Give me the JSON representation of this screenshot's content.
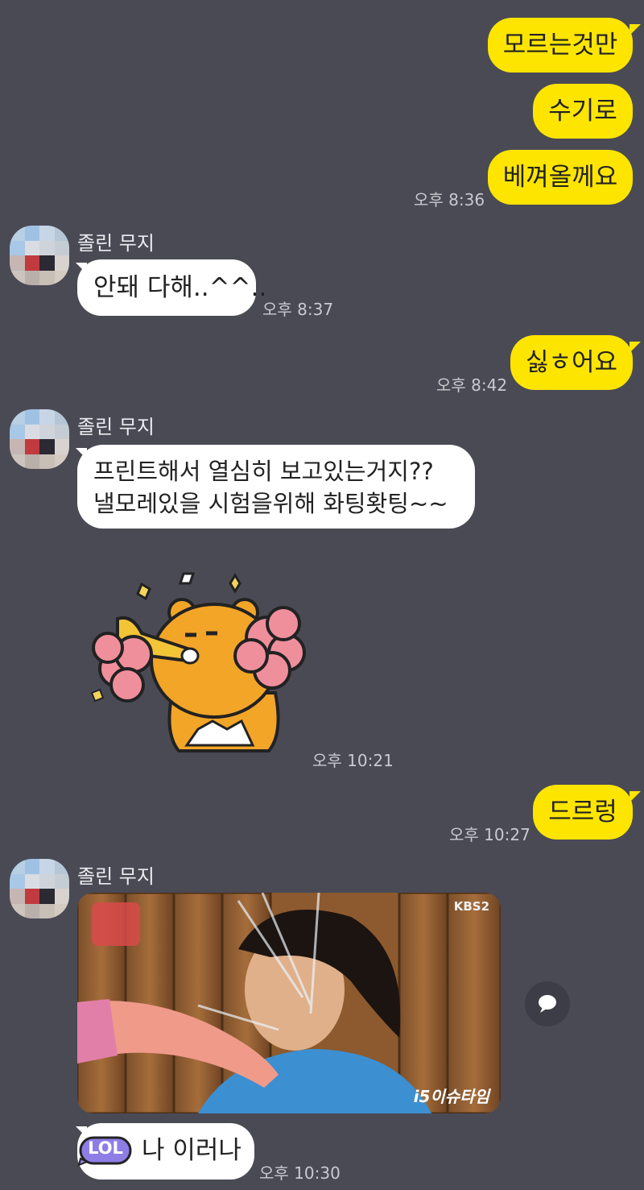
{
  "colors": {
    "background": "#4a4a55",
    "my_bubble": "#fee500",
    "their_bubble": "#ffffff",
    "time": "#c9c9cf"
  },
  "messages": [
    {
      "sender": "me",
      "text": "모르는것만"
    },
    {
      "sender": "me",
      "text": "수기로"
    },
    {
      "sender": "me",
      "text": "베껴올께요",
      "time": "오후 8:36"
    },
    {
      "sender": "졸린 무지",
      "text": "안돼 다해..^^..",
      "time": "오후 8:37"
    },
    {
      "sender": "me",
      "text": "싫ㅎ어요",
      "time": "오후 8:42"
    },
    {
      "sender": "졸린 무지",
      "lines": [
        "프린트해서 열심히 보고있는거지??",
        "낼모레있을 시험을위해 화팅홧팅~~"
      ]
    },
    {
      "sender": "졸린 무지",
      "sticker": "ryan-cheering-sticker",
      "time": "오후 10:21"
    },
    {
      "sender": "me",
      "text": "드르렁",
      "time": "오후 10:27"
    },
    {
      "sender": "졸린 무지",
      "photo": {
        "watermark_tl": "KBS2",
        "watermark_br": "이슈타임",
        "brand_glyph": "i5"
      }
    },
    {
      "sender": "졸린 무지",
      "emoticon": "LOL",
      "text": "나 이러나",
      "time": "오후 10:30"
    }
  ],
  "icons": {
    "share": "speech-bubble-icon"
  }
}
